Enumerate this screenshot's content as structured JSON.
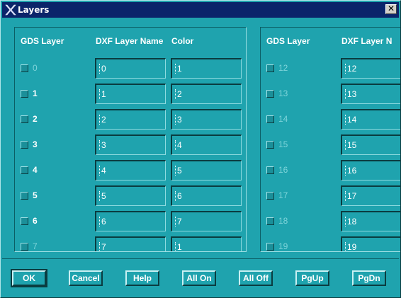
{
  "window": {
    "title": "Layers",
    "close_glyph": "✕",
    "icon": "x-window-icon"
  },
  "headers": {
    "left": {
      "gds": "GDS Layer",
      "dxf": "DXF Layer Name",
      "color": "Color"
    },
    "right": {
      "gds": "GDS Layer",
      "dxf": "DXF Layer N"
    }
  },
  "left_rows": [
    {
      "gds": "0",
      "dxf": "0",
      "color": "1",
      "dim": true
    },
    {
      "gds": "1",
      "dxf": "1",
      "color": "2",
      "dim": false
    },
    {
      "gds": "2",
      "dxf": "2",
      "color": "3",
      "dim": false
    },
    {
      "gds": "3",
      "dxf": "3",
      "color": "4",
      "dim": false
    },
    {
      "gds": "4",
      "dxf": "4",
      "color": "5",
      "dim": false
    },
    {
      "gds": "5",
      "dxf": "5",
      "color": "6",
      "dim": false
    },
    {
      "gds": "6",
      "dxf": "6",
      "color": "7",
      "dim": false
    },
    {
      "gds": "7",
      "dxf": "7",
      "color": "1",
      "dim": true
    }
  ],
  "right_rows": [
    {
      "gds": "12",
      "dxf": "12"
    },
    {
      "gds": "13",
      "dxf": "13"
    },
    {
      "gds": "14",
      "dxf": "14"
    },
    {
      "gds": "15",
      "dxf": "15"
    },
    {
      "gds": "16",
      "dxf": "16"
    },
    {
      "gds": "17",
      "dxf": "17"
    },
    {
      "gds": "18",
      "dxf": "18"
    },
    {
      "gds": "19",
      "dxf": "19"
    }
  ],
  "buttons": {
    "ok": "OK",
    "cancel": "Cancel",
    "help": "Help",
    "all_on": "All On",
    "all_off": "All Off",
    "pg_up": "PgUp",
    "pg_dn": "PgDn"
  },
  "colors": {
    "dialog_bg": "#1fa3ae",
    "titlebar": "#0b246a",
    "dim_text": "#7fd4da"
  }
}
